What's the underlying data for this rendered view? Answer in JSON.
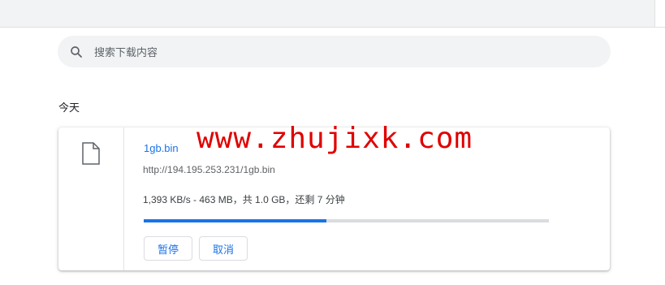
{
  "search": {
    "placeholder": "搜索下载内容",
    "icon": "search-icon"
  },
  "section": {
    "date_heading": "今天"
  },
  "download": {
    "file_icon": "file-icon",
    "file_name": "1gb.bin",
    "url": "http://194.195.253.231/1gb.bin",
    "status": "1,393 KB/s - 463 MB，共 1.0 GB，还剩 7 分钟",
    "progress_fraction": 0.45,
    "buttons": {
      "pause": "暂停",
      "cancel": "取消"
    }
  },
  "watermark": {
    "text": "www.zhujixk.com"
  },
  "colors": {
    "accent": "#1a73e8",
    "watermark": "#e00000",
    "progress_track": "#dadce0"
  }
}
